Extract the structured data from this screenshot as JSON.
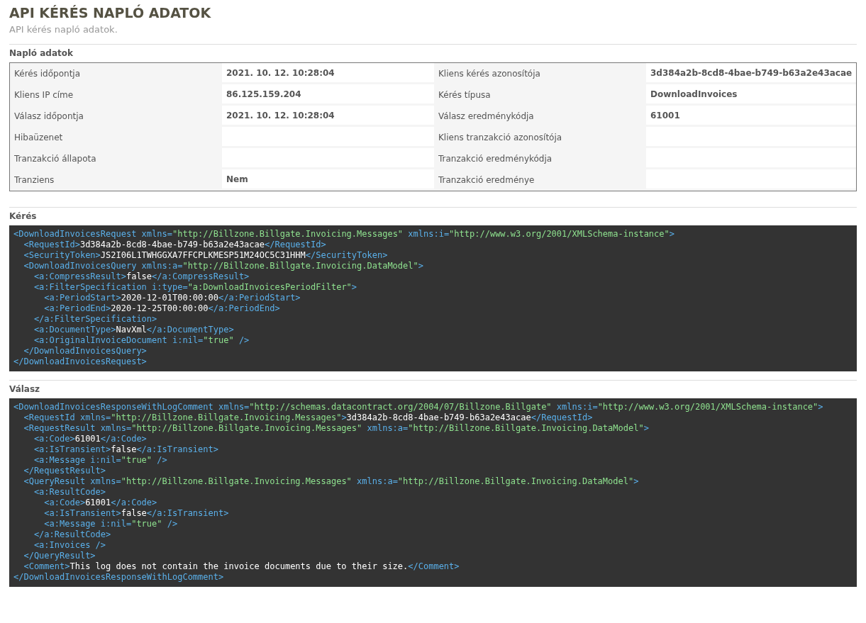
{
  "page": {
    "title": "API KÉRÉS NAPLÓ ADATOK",
    "subtitle": "API kérés napló adatok."
  },
  "log_section": {
    "title": "Napló adatok",
    "rows": [
      {
        "label_1": "Kérés időpontja",
        "value_1": "2021. 10. 12. 10:28:04",
        "label_2": "Kliens kérés azonosítója",
        "value_2": "3d384a2b-8cd8-4bae-b749-b63a2e43acae"
      },
      {
        "label_1": "Kliens IP címe",
        "value_1": "86.125.159.204",
        "label_2": "Kérés típusa",
        "value_2": "DownloadInvoices"
      },
      {
        "label_1": "Válasz időpontja",
        "value_1": "2021. 10. 12. 10:28:04",
        "label_2": "Válasz eredménykódja",
        "value_2": "61001"
      },
      {
        "label_1": "Hibaüzenet",
        "label_2": "Kliens tranzakció azonosítója"
      },
      {
        "label_1": "Tranzakció állapota",
        "label_2": "Tranzakció eredménykódja"
      },
      {
        "label_1": "Tranziens",
        "value_1": "Nem",
        "label_2": "Tranzakció eredménye"
      }
    ]
  },
  "code_sections": [
    {
      "title": "Kérés",
      "lines": [
        {
          "text": "<DownloadInvoicesRequest xmlns=\"http://Billzone.Billgate.Invoicing.Messages\" xmlns:i=\"http://www.w3.org/2001/XMLSchema-instance\">",
          "children": [
            {
              "text": "<RequestId>3d384a2b-8cd8-4bae-b749-b63a2e43acae</RequestId>"
            },
            {
              "text": "<SecurityToken>JS2I06L1TWHGGXA7FFCPLKMESP51M24OC5C31HHM</SecurityToken>"
            },
            {
              "text": "<DownloadInvoicesQuery xmlns:a=\"http://Billzone.Billgate.Invoicing.DataModel\">",
              "children": [
                {
                  "text": "<a:CompressResult>false</a:CompressResult>"
                },
                {
                  "text": "<a:FilterSpecification i:type=\"a:DownloadInvoicesPeriodFilter\">",
                  "children": [
                    {
                      "text": "<a:PeriodStart>2020-12-01T00:00:00</a:PeriodStart>"
                    },
                    {
                      "text": "<a:PeriodEnd>2020-12-25T00:00:00</a:PeriodEnd>"
                    }
                  ]
                },
                {
                  "text": "</a:FilterSpecification>"
                },
                {
                  "text": "<a:DocumentType>NavXml</a:DocumentType>"
                },
                {
                  "text": "<a:OriginalInvoiceDocument i:nil=\"true\" />"
                }
              ]
            },
            {
              "text": "</DownloadInvoicesQuery>"
            }
          ]
        },
        {
          "text": "</DownloadInvoicesRequest>"
        }
      ]
    },
    {
      "title": "Válasz",
      "lines": [
        {
          "text": "<DownloadInvoicesResponseWithLogComment xmlns=\"http://schemas.datacontract.org/2004/07/Billzone.Billgate\" xmlns:i=\"http://www.w3.org/2001/XMLSchema-instance\">",
          "children": [
            {
              "text": "<RequestId xmlns=\"http://Billzone.Billgate.Invoicing.Messages\">3d384a2b-8cd8-4bae-b749-b63a2e43acae</RequestId>"
            },
            {
              "text": "<RequestResult xmlns=\"http://Billzone.Billgate.Invoicing.Messages\" xmlns:a=\"http://Billzone.Billgate.Invoicing.DataModel\">",
              "children": [
                {
                  "text": "<a:Code>61001</a:Code>"
                },
                {
                  "text": "<a:IsTransient>false</a:IsTransient>"
                },
                {
                  "text": "<a:Message i:nil=\"true\" />"
                }
              ]
            },
            {
              "text": "</RequestResult>"
            },
            {
              "text": "<QueryResult xmlns=\"http://Billzone.Billgate.Invoicing.Messages\" xmlns:a=\"http://Billzone.Billgate.Invoicing.DataModel\">",
              "children": [
                {
                  "text": "<a:ResultCode>",
                  "children": [
                    {
                      "text": "<a:Code>61001</a:Code>"
                    },
                    {
                      "text": "<a:IsTransient>false</a:IsTransient>"
                    },
                    {
                      "text": "<a:Message i:nil=\"true\" />"
                    }
                  ]
                },
                {
                  "text": "</a:ResultCode>"
                },
                {
                  "text": "<a:Invoices />"
                }
              ]
            },
            {
              "text": "</QueryResult>"
            },
            {
              "text": "<Comment>This log does not contain the invoice documents due to their size.</Comment>"
            }
          ]
        },
        {
          "text": "</DownloadInvoicesResponseWithLogComment>"
        }
      ]
    }
  ]
}
